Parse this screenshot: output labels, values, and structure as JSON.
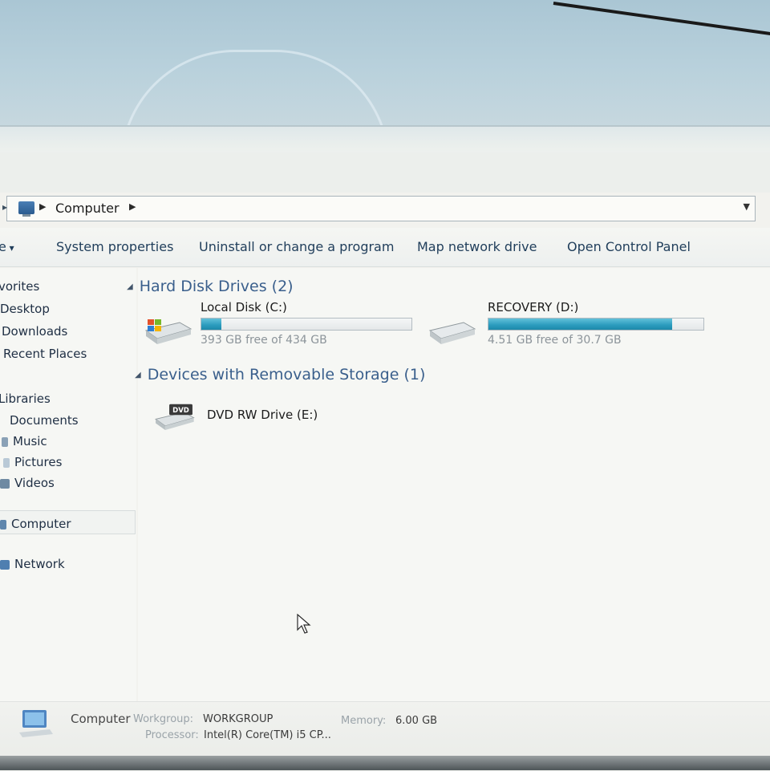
{
  "address": {
    "path_label": "Computer"
  },
  "commands": {
    "organize_fragment": "e",
    "items": [
      "System properties",
      "Uninstall or change a program",
      "Map network drive",
      "Open Control Panel"
    ]
  },
  "nav": {
    "favorites": "vorites",
    "desktop": "Desktop",
    "downloads": "Downloads",
    "recent_places": "Recent Places",
    "libraries": "Libraries",
    "documents": "Documents",
    "music": "Music",
    "pictures": "Pictures",
    "videos": "Videos",
    "computer": "Computer",
    "network": "Network"
  },
  "groups": {
    "hard_disk": "Hard Disk Drives (2)",
    "removable": "Devices with Removable Storage (1)"
  },
  "drives": [
    {
      "name": "Local Disk (C:)",
      "free_text": "393 GB free of 434 GB",
      "used_fraction": 0.094
    },
    {
      "name": "RECOVERY (D:)",
      "free_text": "4.51 GB free of 30.7 GB",
      "used_fraction": 0.853
    }
  ],
  "removable": {
    "name": "DVD RW Drive (E:)",
    "icon_text": "DVD"
  },
  "details": {
    "title": "Computer",
    "workgroup_label": "Workgroup:",
    "workgroup_value": "WORKGROUP",
    "memory_label": "Memory:",
    "memory_value": "6.00 GB",
    "processor_label": "Processor:",
    "processor_value": "Intel(R) Core(TM) i5 CP..."
  },
  "colors": {
    "accent": "#3a5f8c",
    "bar_fill": "#2a9bbd"
  }
}
